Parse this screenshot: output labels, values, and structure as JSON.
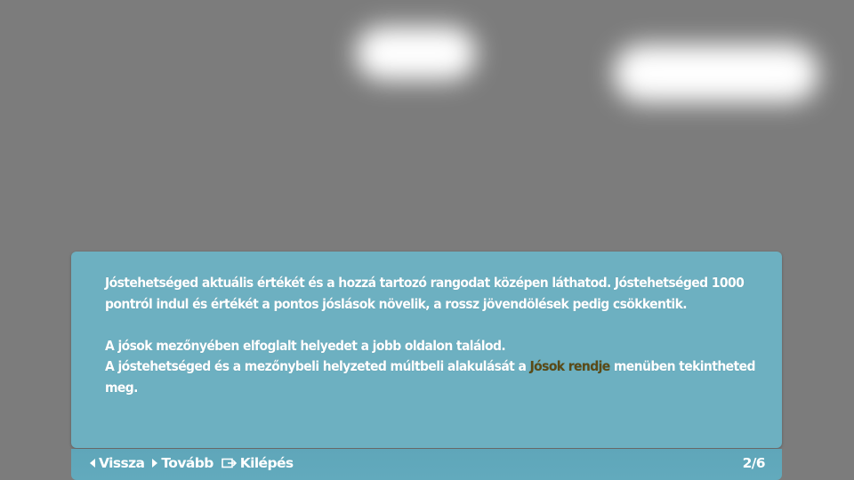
{
  "dialog": {
    "paragraph1": "Jóstehetséged aktuális értékét és a hozzá tartozó rangodat középen láthatod. Jóstehetséged 1000 pontról indul és értékét a pontos jóslások növelik, a rossz jövendölések pedig csökkentik.",
    "paragraph2": "A jósok mezőnyében elfoglalt helyedet a jobb oldalon találod.",
    "paragraph3_before": "A jóstehetséged és a mezőnybeli helyzeted múltbeli alakulását a ",
    "paragraph3_highlight": "Jósok rendje",
    "paragraph3_after": " menüben tekintheted meg.",
    "highlight_color": "#5a4a16"
  },
  "footer": {
    "back_label": "Vissza",
    "next_label": "Tovább",
    "exit_label": "Kilépés",
    "page_counter": "2/6",
    "icons": {
      "back": "triangle-left-icon",
      "next": "triangle-right-icon",
      "exit": "exit-icon"
    }
  },
  "colors": {
    "panel": "#6db0c1",
    "background": "#7c7c7c",
    "text": "#ffffff"
  }
}
